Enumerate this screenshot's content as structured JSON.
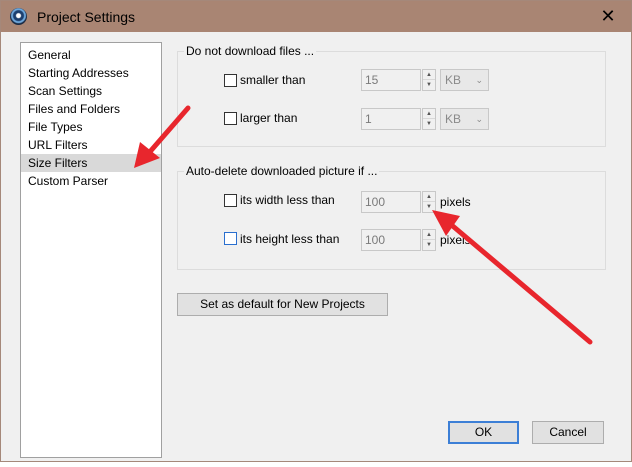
{
  "window": {
    "title": "Project Settings",
    "close_symbol": "✕"
  },
  "nav": {
    "items": [
      {
        "label": "General"
      },
      {
        "label": "Starting Addresses"
      },
      {
        "label": "Scan Settings"
      },
      {
        "label": "Files and Folders"
      },
      {
        "label": "File Types"
      },
      {
        "label": "URL Filters"
      },
      {
        "label": "Size Filters",
        "selected": true
      },
      {
        "label": "Custom Parser"
      }
    ]
  },
  "download_group": {
    "title": "Do not download files ...",
    "smaller": {
      "label": "smaller than",
      "checked": false,
      "value": "15",
      "unit": "KB"
    },
    "larger": {
      "label": "larger than",
      "checked": false,
      "value": "1",
      "unit": "KB"
    }
  },
  "autodelete_group": {
    "title": "Auto-delete downloaded picture if ...",
    "width": {
      "label": "its width less than",
      "checked": false,
      "value": "100",
      "unit": "pixels"
    },
    "height": {
      "label": "its height less than",
      "checked": false,
      "value": "100",
      "unit": "pixels"
    }
  },
  "buttons": {
    "set_default": "Set as default for New Projects",
    "ok": "OK",
    "cancel": "Cancel"
  },
  "icons": {
    "app": "app-globe-icon",
    "close": "close-icon",
    "spin_up": "▲",
    "spin_down": "▼",
    "dropdown": "chevron-down-icon"
  },
  "colors": {
    "titlebar": "#a98573",
    "annotation_arrow": "#e8262d",
    "focus_blue": "#3c7fd6"
  }
}
